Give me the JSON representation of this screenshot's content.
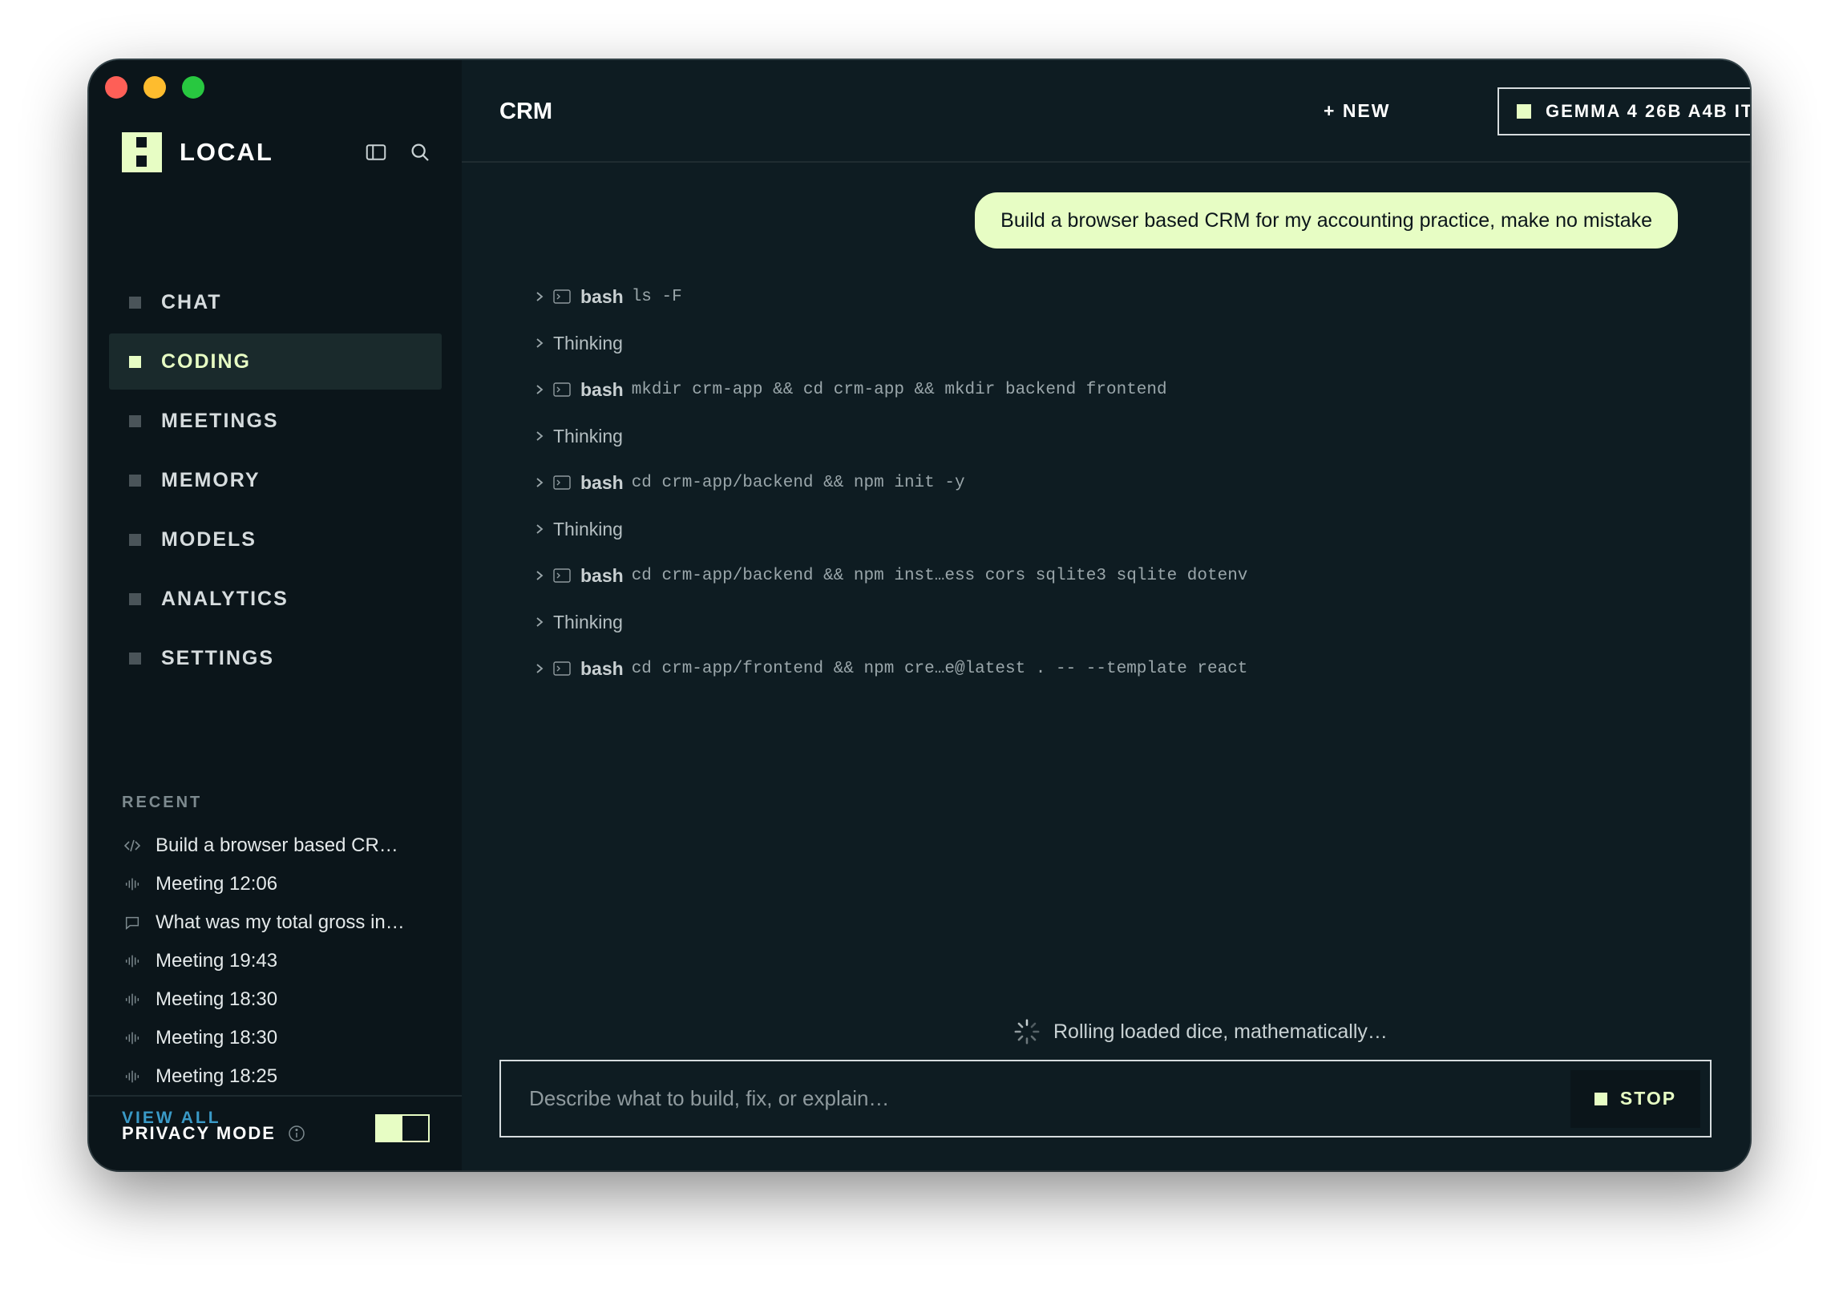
{
  "app": {
    "name": "LOCAL"
  },
  "sidebar": {
    "nav": [
      {
        "label": "CHAT",
        "active": false
      },
      {
        "label": "CODING",
        "active": true
      },
      {
        "label": "MEETINGS",
        "active": false
      },
      {
        "label": "MEMORY",
        "active": false
      },
      {
        "label": "MODELS",
        "active": false
      },
      {
        "label": "ANALYTICS",
        "active": false
      },
      {
        "label": "SETTINGS",
        "active": false
      }
    ],
    "recent_title": "RECENT",
    "recent": [
      {
        "icon": "code-icon",
        "label": "Build a browser based CR…"
      },
      {
        "icon": "waveform-icon",
        "label": "Meeting 12:06"
      },
      {
        "icon": "chat-bubble-icon",
        "label": "What was my total gross in…"
      },
      {
        "icon": "waveform-icon",
        "label": "Meeting 19:43"
      },
      {
        "icon": "waveform-icon",
        "label": "Meeting 18:30"
      },
      {
        "icon": "waveform-icon",
        "label": "Meeting 18:30"
      },
      {
        "icon": "waveform-icon",
        "label": "Meeting 18:25"
      }
    ],
    "view_all": "VIEW ALL",
    "privacy_label": "PRIVACY MODE",
    "privacy_on": true
  },
  "header": {
    "title": "CRM",
    "new_label": "+ NEW",
    "model_label": "GEMMA 4 26B A4B IT"
  },
  "conversation": {
    "user_message": "Build a browser based CRM for my accounting practice, make no mistake",
    "log": [
      {
        "type": "bash",
        "keyword": "bash",
        "command": "ls -F"
      },
      {
        "type": "thinking",
        "text": "Thinking"
      },
      {
        "type": "bash",
        "keyword": "bash",
        "command": "mkdir crm-app && cd crm-app && mkdir backend frontend"
      },
      {
        "type": "thinking",
        "text": "Thinking"
      },
      {
        "type": "bash",
        "keyword": "bash",
        "command": "cd crm-app/backend && npm init -y"
      },
      {
        "type": "thinking",
        "text": "Thinking"
      },
      {
        "type": "bash",
        "keyword": "bash",
        "command": "cd crm-app/backend && npm inst…ess cors sqlite3 sqlite dotenv"
      },
      {
        "type": "thinking",
        "text": "Thinking"
      },
      {
        "type": "bash",
        "keyword": "bash",
        "command": "cd crm-app/frontend && npm cre…e@latest . -- --template react"
      }
    ],
    "status_text": "Rolling loaded dice, mathematically…"
  },
  "composer": {
    "placeholder": "Describe what to build, fix, or explain…",
    "value": "",
    "stop_label": "STOP"
  },
  "colors": {
    "accent": "#e7fdc4",
    "background": "#0e1c22",
    "sidebar": "#0b151a",
    "link": "#3a9ac7"
  }
}
